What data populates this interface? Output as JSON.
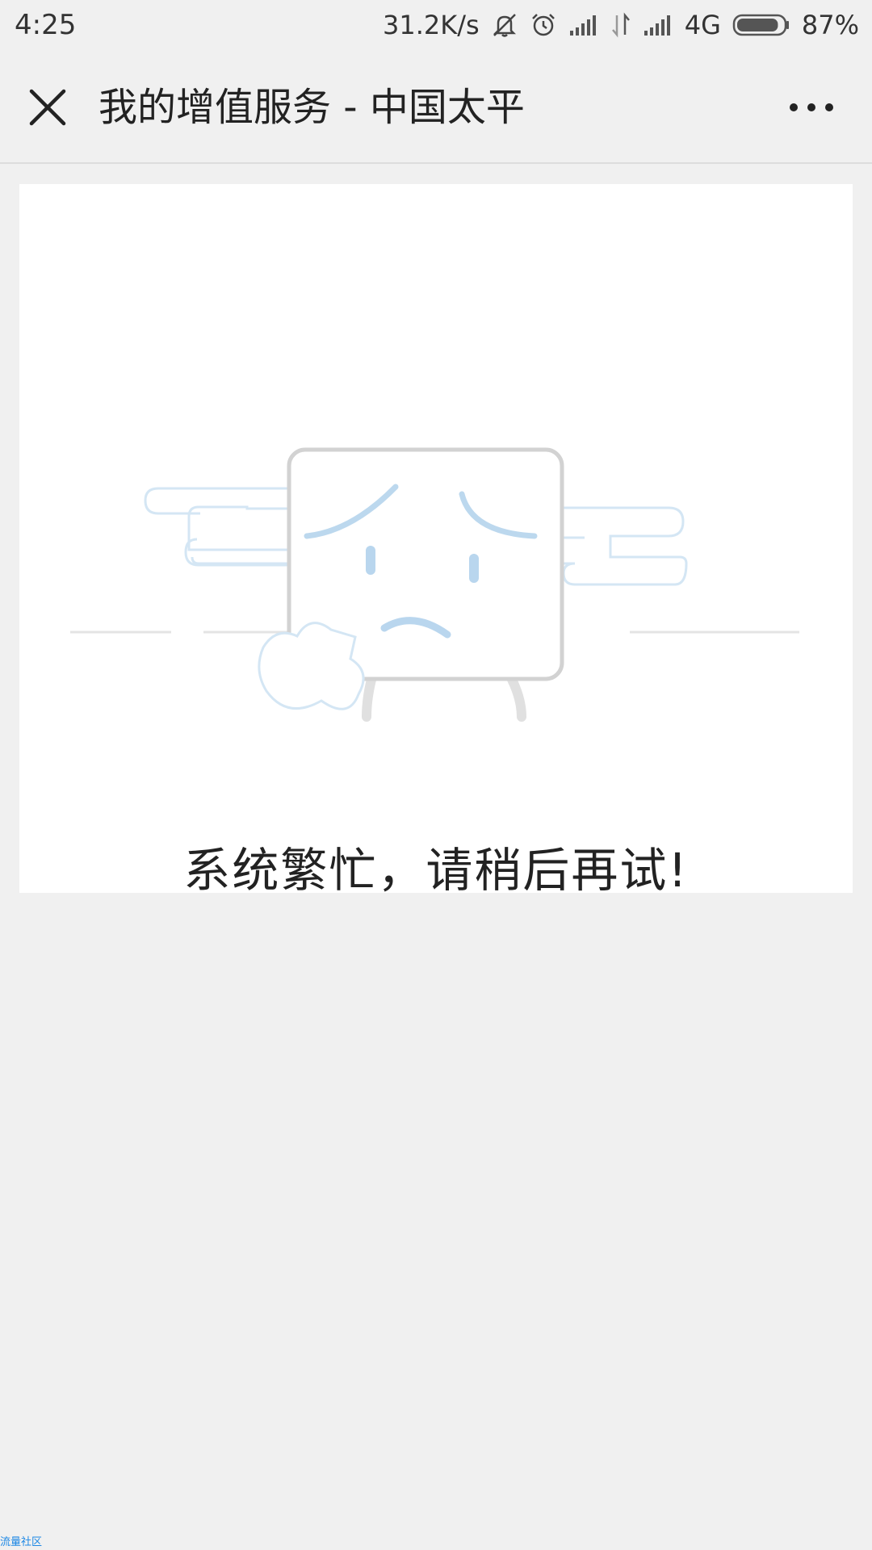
{
  "status_bar": {
    "time": "4:25",
    "network_speed": "31.2K/s",
    "icons": [
      "mute-icon",
      "alarm-icon",
      "signal-icon",
      "data-arrows-icon",
      "signal-icon",
      "battery-icon"
    ],
    "network_type": "4G",
    "battery_percent": "87%",
    "battery_level": 0.87
  },
  "header": {
    "close_icon": "close-icon",
    "title": "我的增值服务 - 中国太平",
    "more_icon": "more-dots-icon"
  },
  "main": {
    "illustration": "sad-box-character",
    "error_message": "系统繁忙，请稍后再试!",
    "colors": {
      "outline_gray": "#d2d2d2",
      "accent_blue": "#b9d6ee"
    }
  },
  "watermark": {
    "text": "流量社区"
  }
}
